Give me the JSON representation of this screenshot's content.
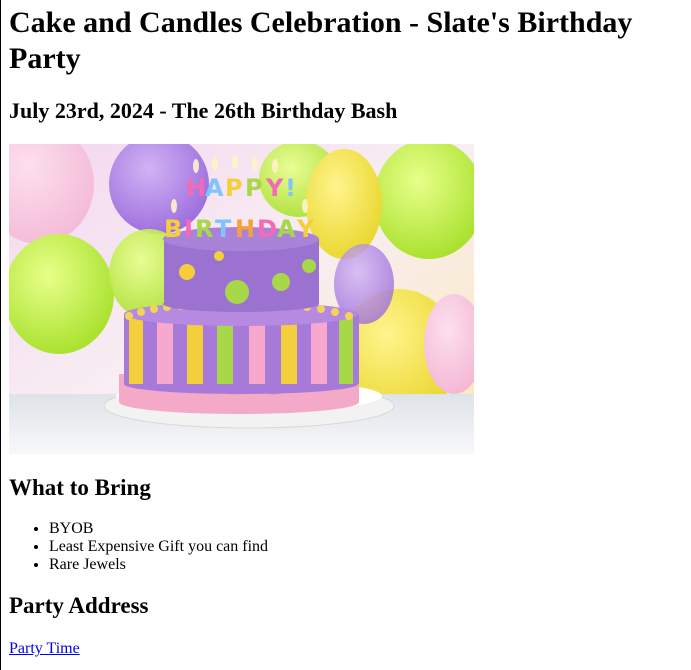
{
  "page": {
    "title": "Cake and Candles Celebration - Slate's Birthday Party",
    "subtitle": "July 23rd, 2024 - The 26th Birthday Bash"
  },
  "hero_image": {
    "cake_text_line1": "HAPPY",
    "cake_text_line2": "BIRTHDAY"
  },
  "bring": {
    "heading": "What to Bring",
    "items": [
      "BYOB",
      "Least Expensive Gift you can find",
      "Rare Jewels"
    ]
  },
  "address": {
    "heading": "Party Address",
    "link_label": "Party Time"
  },
  "colors": {
    "link": "#0000ee",
    "cake_purple": "#9b6ed4",
    "cake_pink": "#f0a6c8",
    "cake_yellow": "#f4cf3c",
    "cake_green": "#a8d84a"
  }
}
